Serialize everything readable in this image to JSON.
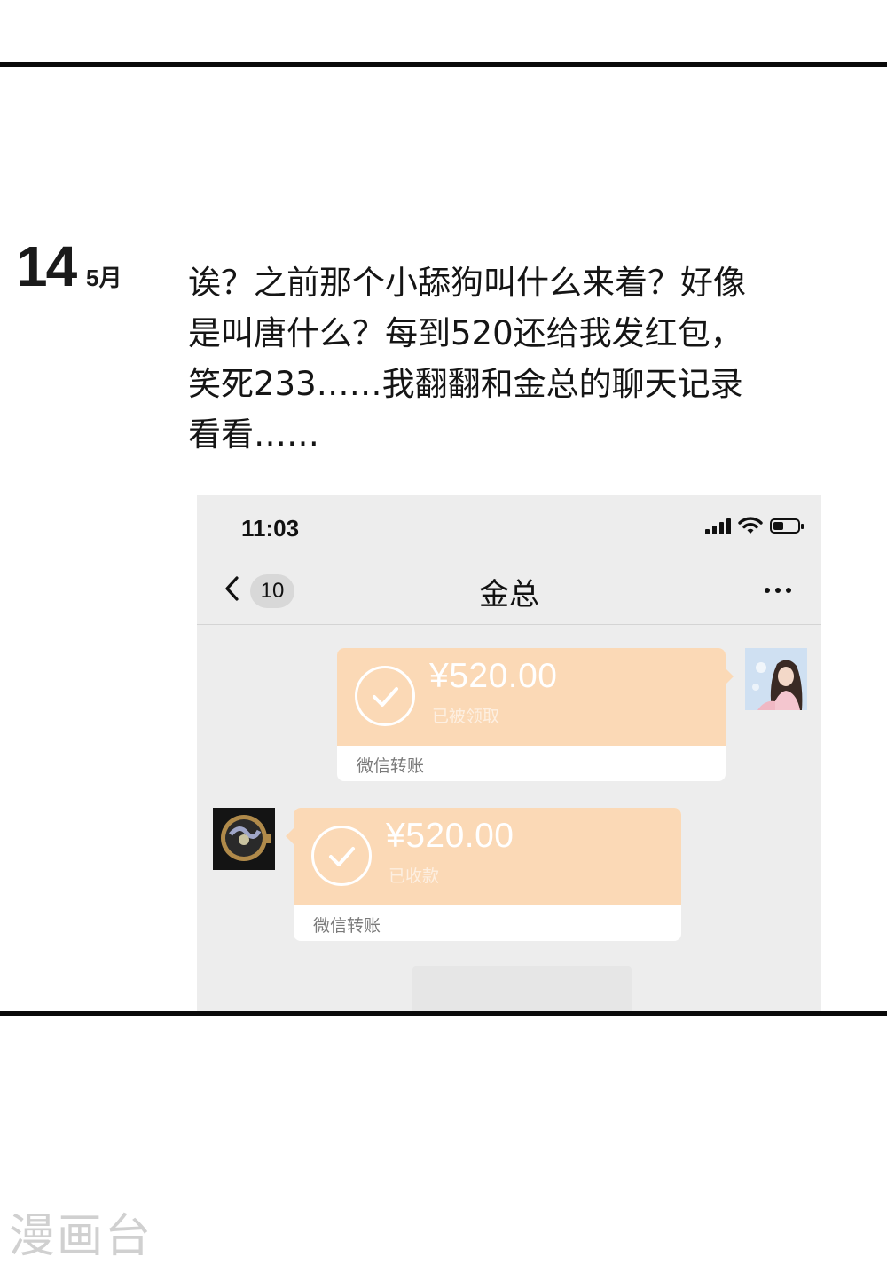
{
  "entry": {
    "day": "14",
    "month": "5月",
    "text": "诶？之前那个小舔狗叫什么来着？好像\n是叫唐什么？每到520还给我发红包，\n笑死233……我翻翻和金总的聊天记录\n看看……"
  },
  "phone": {
    "status_time": "11:03",
    "back_badge": "10",
    "chat_title": "金总",
    "messages": [
      {
        "side": "right",
        "amount": "¥520.00",
        "status": "已被领取",
        "label": "微信转账"
      },
      {
        "side": "left",
        "amount": "¥520.00",
        "status": "已收款",
        "label": "微信转账"
      }
    ]
  },
  "watermark": "漫画台",
  "colors": {
    "transfer_bg": "#fbd9b6",
    "chat_bg": "#ededed",
    "rule": "#0a0a0a"
  }
}
